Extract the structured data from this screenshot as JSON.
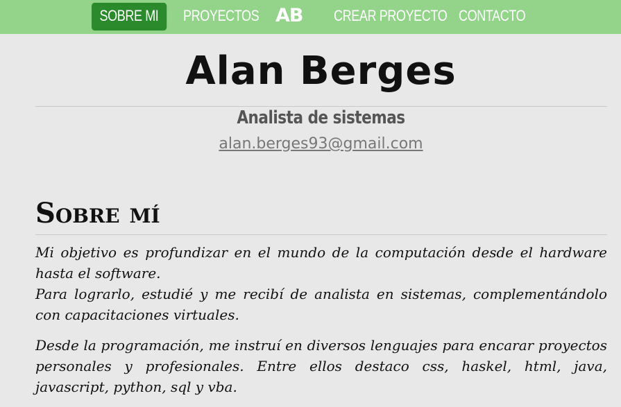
{
  "nav": {
    "items": [
      "SOBRE MI",
      "PROYECTOS",
      "CREAR PROYECTO",
      "CONTACTO"
    ],
    "logo": "AB"
  },
  "header": {
    "name": "Alan Berges",
    "role": "Analista de sistemas",
    "email": "alan.berges93@gmail.com"
  },
  "about": {
    "title": "Sobre mí",
    "p1_line1": "Mi objetivo es profundizar en el mundo de la computación desde el hardware hasta el software.",
    "p1_line2": "Para lograrlo, estudié y me recibí de analista en sistemas, complementándolo con capacitaciones virtuales.",
    "p2": "Desde la programación, me instruí en diversos lenguajes para encarar proyectos personales y profesionales. Entre ellos destaco css, haskel, html, java, javascript, python, sql y vba."
  },
  "colors": {
    "navbar": "#93d38a",
    "active_tab": "#2b8a2b",
    "background": "#e8e8e8"
  }
}
